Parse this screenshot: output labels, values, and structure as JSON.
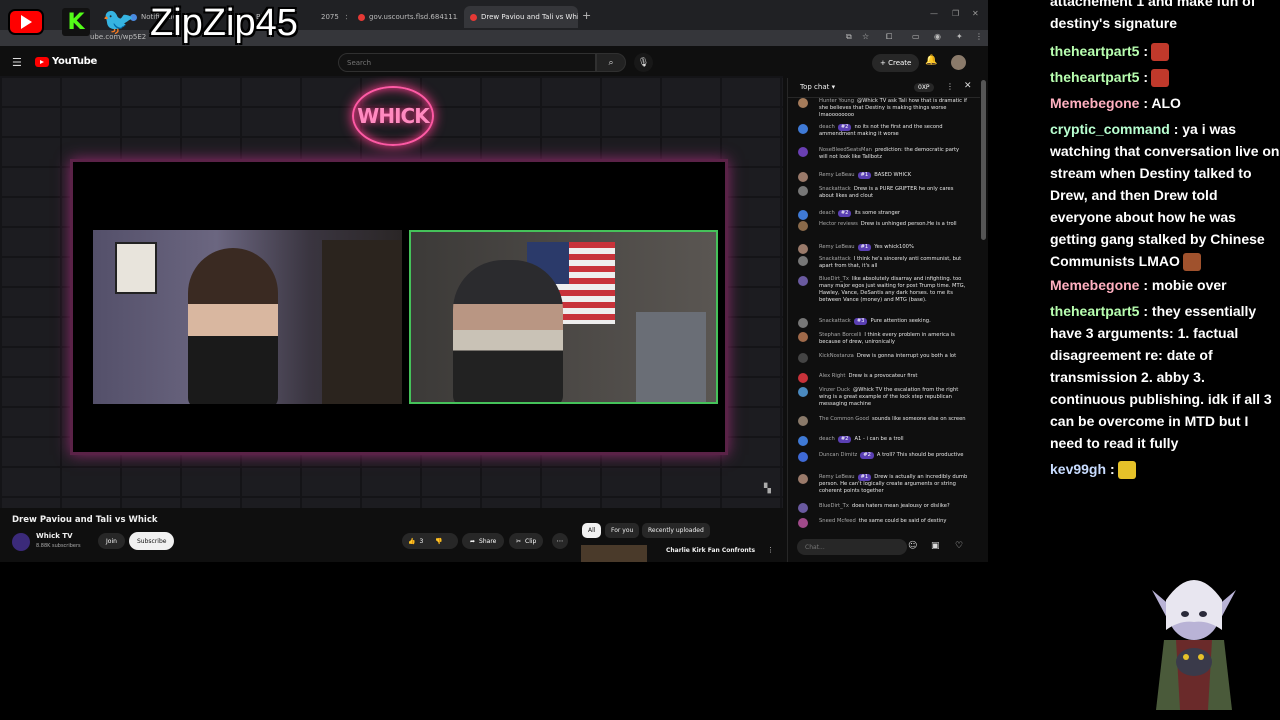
{
  "browser": {
    "tabs": [
      {
        "label": "Notification",
        "active": false
      },
      {
        "label": "Bitl...",
        "active": false
      },
      {
        "label": "2075",
        "active": false
      },
      {
        "label": "gov.uscourts.flsd.684111.132.0",
        "active": false
      },
      {
        "label": "Drew Paviou and Tali vs Whick",
        "active": true
      }
    ],
    "new_tab": "+",
    "url": "ube.com/wp5E2"
  },
  "overlay": {
    "streamer_name": "ZipZip45"
  },
  "youtube": {
    "brand": "YouTube",
    "search_placeholder": "Search",
    "create_label": "Create"
  },
  "video": {
    "neon_sign": "WHICK",
    "title": "Drew Paviou and Tali vs Whick",
    "channel_name": "Whick TV",
    "subscribers": "8.88K subscribers",
    "join_label": "Join",
    "subscribe_label": "Subscribe",
    "like_count": "3",
    "share_label": "Share",
    "clip_label": "Clip"
  },
  "recommendations": {
    "chips": [
      "All",
      "For you",
      "Recently uploaded"
    ],
    "first_title": "Charlie Kirk Fan Confronts"
  },
  "yt_chat": {
    "header": "Top chat",
    "xp_badge": "0XP",
    "input_placeholder": "Chat...",
    "messages": [
      {
        "author": "Hunter Young",
        "badge": "",
        "text": "@Whick TV ask Tali how that is dramatic if she believes that Destiny is making things worse lmaoooooooo",
        "color": "#a57b5a"
      },
      {
        "author": "deach",
        "badge": "#2",
        "text": "no its not the first and the second ammendment making it worse",
        "color": "#3f7ad6"
      },
      {
        "author": "NoseBleedSeatsMan",
        "badge": "",
        "text": "prediction: the democratic party will not look like Tallbotz",
        "color": "#6a3fb3"
      },
      {
        "author": "Remy LeBeau",
        "badge": "#1",
        "text": "BASED WHICK",
        "color": "#9a7a6a"
      },
      {
        "author": "Snackattack",
        "badge": "",
        "text": "Drew is a PURE GRIFTER he only cares about likes and clout",
        "color": "#777"
      },
      {
        "author": "deach",
        "badge": "#2",
        "text": "its some stranger",
        "color": "#3f7ad6"
      },
      {
        "author": "Hector reviews",
        "badge": "",
        "text": "Drew is unhinged person.He is a troll",
        "color": "#8a6a4a"
      },
      {
        "author": "Remy LeBeau",
        "badge": "#1",
        "text": "Yes whick100%",
        "color": "#9a7a6a"
      },
      {
        "author": "Snackattack",
        "badge": "",
        "text": "I think he's sincerely anti communist, but apart from that, it's all",
        "color": "#777"
      },
      {
        "author": "BlueDirt_Tx",
        "badge": "",
        "text": "like absolutely disarray and infighting. too many major egos just waiting for post Trump time. MTG, Hawley, Vance, DeSantis any dark horses. to me its between Vance (money) and MTG (base).",
        "color": "#6a5aa0"
      },
      {
        "author": "Snackattack",
        "badge": "#3",
        "text": "Pure attention seeking.",
        "color": "#777"
      },
      {
        "author": "Stephan Borcelli",
        "badge": "",
        "text": "I think every problem in america is because of drew, unironically",
        "color": "#a06a4a"
      },
      {
        "author": "KickNostanza",
        "badge": "",
        "text": "Drew is gonna interrupt you both a lot",
        "color": "#444"
      },
      {
        "author": "Alex Right",
        "badge": "",
        "text": "Drew is a provocateur first",
        "color": "#c8323a"
      },
      {
        "author": "Vinzer Duck",
        "badge": "",
        "text": "@Whick TV the escalation from the right wing is a great example of the lock step republican messaging machine",
        "color": "#4a8ac0"
      },
      {
        "author": "The Common Good",
        "badge": "",
        "text": "sounds like someone else on screen",
        "color": "#8a7a6a"
      },
      {
        "author": "deach",
        "badge": "#2",
        "text": "A1 - i can be a troll",
        "color": "#3f7ad6"
      },
      {
        "author": "Duncan Dimitz",
        "badge": "#2",
        "text": "A troll? This should be productive",
        "color": "#3f6ad6"
      },
      {
        "author": "Remy LeBeau",
        "badge": "#1",
        "text": "Drew is actually an incredibly dumb person. He can't logically create arguments or string coherent points together",
        "color": "#9a7a6a"
      },
      {
        "author": "BlueDirt_Tx",
        "badge": "",
        "text": "does haters mean jealousy or dislike?",
        "color": "#6a5aa0"
      },
      {
        "author": "Sneed Mcfeed",
        "badge": "",
        "text": "the same could be said of destiny",
        "color": "#a04a8a"
      }
    ]
  },
  "stream_chat": {
    "messages": [
      {
        "user": "",
        "text": "attachement 1 and make fun of destiny's signature",
        "user_color": "#ffffff",
        "emote": ""
      },
      {
        "user": "theheartpart5",
        "text": ":",
        "user_color": "#b8ffb0",
        "emote": "#c0392b"
      },
      {
        "user": "theheartpart5",
        "text": ":",
        "user_color": "#b8ffb0",
        "emote": "#c0392b"
      },
      {
        "user": "Memebegone",
        "text": ": ALO",
        "user_color": "#ffb0c0",
        "emote": ""
      },
      {
        "user": "cryptic_command",
        "text": ": ya i was watching that conversation live on stream when Destiny talked to Drew, and then Drew told everyone about how he was getting gang stalked by Chinese Communists LMAO",
        "user_color": "#b8ffd0",
        "emote": "#a0522d"
      },
      {
        "user": "Memebegone",
        "text": ": mobie over",
        "user_color": "#ffb0c0",
        "emote": ""
      },
      {
        "user": "theheartpart5",
        "text": ": they essentially have 3 arguments: 1. factual disagreement re: date of transmission 2. abby 3. continuous publishing. idk if all 3 can be overcome in MTD but I need to read it fully",
        "user_color": "#b8ffb0",
        "emote": ""
      },
      {
        "user": "kev99gh",
        "text": ":",
        "user_color": "#c8dcff",
        "emote": "#e6c229"
      }
    ]
  }
}
